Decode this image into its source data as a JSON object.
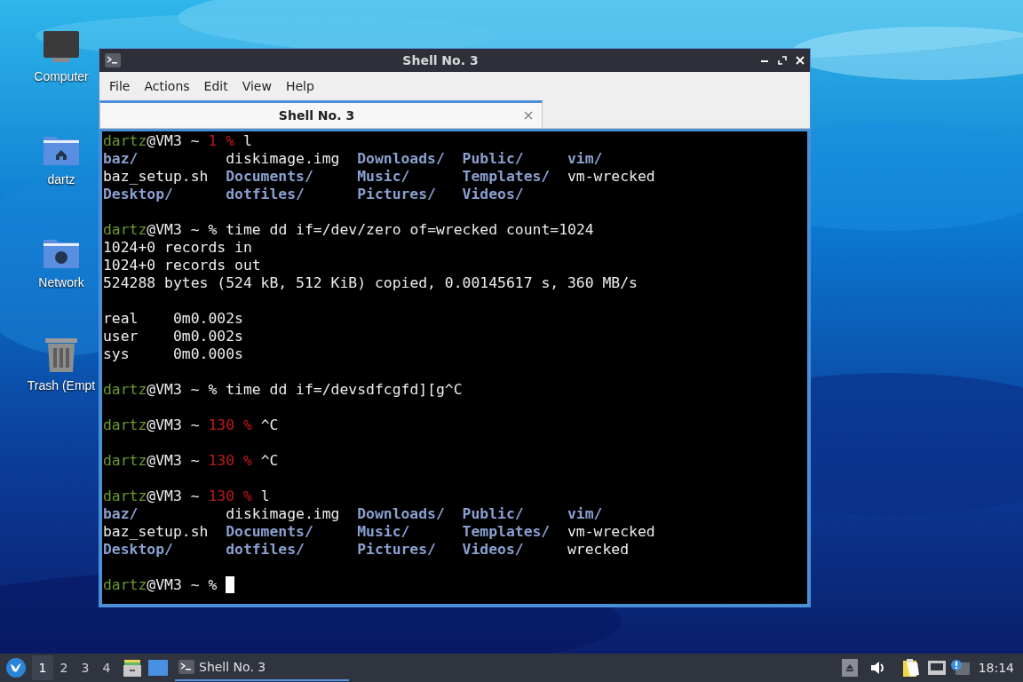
{
  "desktop_icons": [
    {
      "kind": "computer",
      "label": "Computer"
    },
    {
      "kind": "home",
      "label": "dartz"
    },
    {
      "kind": "network",
      "label": "Network"
    },
    {
      "kind": "trash",
      "label": "Trash (Empt"
    }
  ],
  "window": {
    "title": "Shell No. 3",
    "menu": [
      "File",
      "Actions",
      "Edit",
      "View",
      "Help"
    ],
    "tabs": [
      {
        "label": "Shell No. 3",
        "selected": true
      }
    ],
    "terminal": [
      {
        "kind": "prompt",
        "user": "dartz",
        "host": "@VM3 ~",
        "status": "1",
        "sign": "%",
        "command": "l"
      },
      {
        "kind": "listing",
        "rows": [
          [
            {
              "text": "baz/",
              "dir": true
            },
            {
              "text": "diskimage.img",
              "dir": false
            },
            {
              "text": "Downloads/",
              "dir": true
            },
            {
              "text": "Public/",
              "dir": true
            },
            {
              "text": "vim/",
              "dir": true
            }
          ],
          [
            {
              "text": "baz_setup.sh",
              "dir": false
            },
            {
              "text": "Documents/",
              "dir": true
            },
            {
              "text": "Music/",
              "dir": true
            },
            {
              "text": "Templates/",
              "dir": true
            },
            {
              "text": "vm-wrecked",
              "dir": false
            }
          ],
          [
            {
              "text": "Desktop/",
              "dir": true
            },
            {
              "text": "dotfiles/",
              "dir": true
            },
            {
              "text": "Pictures/",
              "dir": true
            },
            {
              "text": "Videos/",
              "dir": true
            }
          ]
        ]
      },
      {
        "kind": "blank"
      },
      {
        "kind": "prompt",
        "user": "dartz",
        "host": "@VM3 ~",
        "sign": "%",
        "command": "time dd if=/dev/zero of=wrecked count=1024"
      },
      {
        "kind": "output",
        "text": "1024+0 records in"
      },
      {
        "kind": "output",
        "text": "1024+0 records out"
      },
      {
        "kind": "output",
        "text": "524288 bytes (524 kB, 512 KiB) copied, 0.00145617 s, 360 MB/s"
      },
      {
        "kind": "blank"
      },
      {
        "kind": "output",
        "text": "real    0m0.002s"
      },
      {
        "kind": "output",
        "text": "user    0m0.002s"
      },
      {
        "kind": "output",
        "text": "sys     0m0.000s"
      },
      {
        "kind": "blank"
      },
      {
        "kind": "prompt",
        "user": "dartz",
        "host": "@VM3 ~",
        "sign": "%",
        "command": "time dd if=/devsdfcgfd][g^C"
      },
      {
        "kind": "blank"
      },
      {
        "kind": "prompt",
        "user": "dartz",
        "host": "@VM3 ~",
        "status": "130",
        "sign": "%",
        "command": "^C"
      },
      {
        "kind": "blank"
      },
      {
        "kind": "prompt",
        "user": "dartz",
        "host": "@VM3 ~",
        "status": "130",
        "sign": "%",
        "command": "^C"
      },
      {
        "kind": "blank"
      },
      {
        "kind": "prompt",
        "user": "dartz",
        "host": "@VM3 ~",
        "status": "130",
        "sign": "%",
        "command": "l"
      },
      {
        "kind": "listing",
        "rows": [
          [
            {
              "text": "baz/",
              "dir": true
            },
            {
              "text": "diskimage.img",
              "dir": false
            },
            {
              "text": "Downloads/",
              "dir": true
            },
            {
              "text": "Public/",
              "dir": true
            },
            {
              "text": "vim/",
              "dir": true
            }
          ],
          [
            {
              "text": "baz_setup.sh",
              "dir": false
            },
            {
              "text": "Documents/",
              "dir": true
            },
            {
              "text": "Music/",
              "dir": true
            },
            {
              "text": "Templates/",
              "dir": true
            },
            {
              "text": "vm-wrecked",
              "dir": false
            }
          ],
          [
            {
              "text": "Desktop/",
              "dir": true
            },
            {
              "text": "dotfiles/",
              "dir": true
            },
            {
              "text": "Pictures/",
              "dir": true
            },
            {
              "text": "Videos/",
              "dir": true
            },
            {
              "text": "wrecked",
              "dir": false
            }
          ]
        ]
      },
      {
        "kind": "blank"
      },
      {
        "kind": "prompt",
        "user": "dartz",
        "host": "@VM3 ~",
        "sign": "%",
        "cursor": true
      }
    ]
  },
  "taskbar": {
    "workspaces": [
      {
        "label": "1",
        "selected": true
      },
      {
        "label": "2",
        "selected": false
      },
      {
        "label": "3",
        "selected": false
      },
      {
        "label": "4",
        "selected": false
      }
    ],
    "tasks": [
      {
        "label": "Shell No. 3",
        "selected": true
      }
    ],
    "clock": "18:14"
  }
}
